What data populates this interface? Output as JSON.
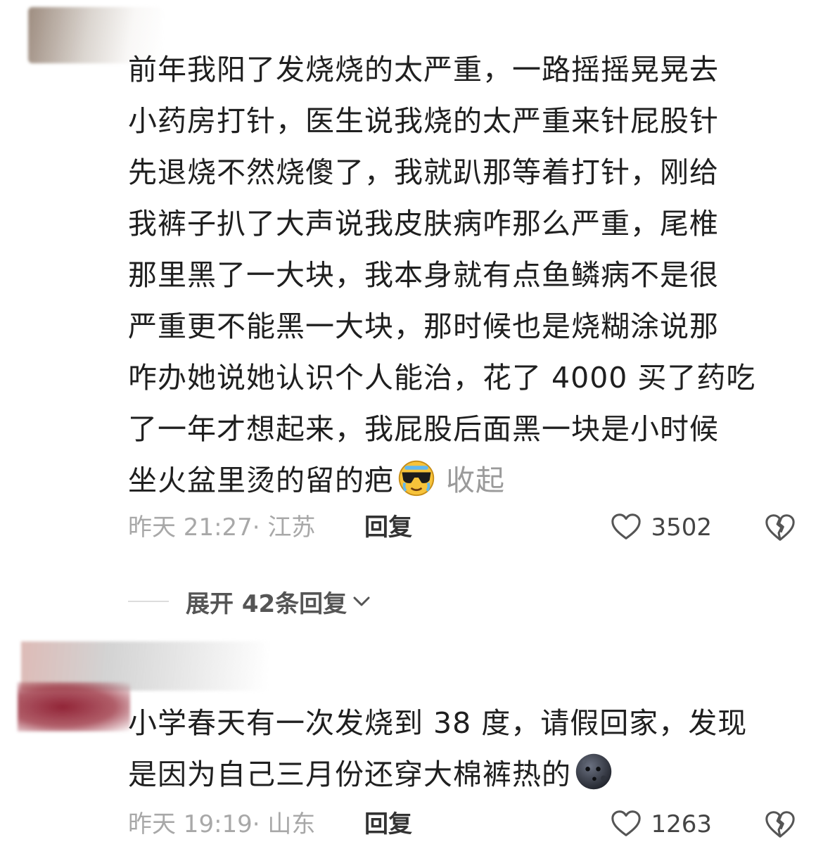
{
  "comments": [
    {
      "text_lines": [
        "前年我阳了发烧烧的太严重，一路摇摇晃晃去",
        "小药房打针，医生说我烧的太严重来针屁股针",
        "先退烧不然烧傻了，我就趴那等着打针，刚给",
        "我裤子扒了大声说我皮肤病咋那么严重，尾椎",
        "那里黑了一大块，我本身就有点鱼鳞病不是很",
        "严重更不能黑一大块，那时候也是烧糊涂说那",
        "咋办她说她认识个人能治，花了 4000 买了药吃",
        "了一年才想起来，我屁股后面黑一块是小时候",
        "坐火盆里烫的留的疤"
      ],
      "emoji": "sunglasses-crying-emoji",
      "collapse_label": "收起",
      "time_location": "昨天 21:27· 江苏",
      "reply_label": "回复",
      "likes": "3502",
      "expand_label": "展开 42条回复"
    },
    {
      "text_lines": [
        "小学春天有一次发烧到 38 度，请假回家，发现",
        "是因为自己三月份还穿大棉裤热的"
      ],
      "emoji": "new-moon-face-emoji",
      "time_location": "昨天 19:19· 山东",
      "reply_label": "回复",
      "likes": "1263"
    }
  ],
  "colors": {
    "text": "#1f1f1f",
    "meta": "#a8a8a8",
    "reply": "#333333",
    "divider": "#dddddd"
  }
}
